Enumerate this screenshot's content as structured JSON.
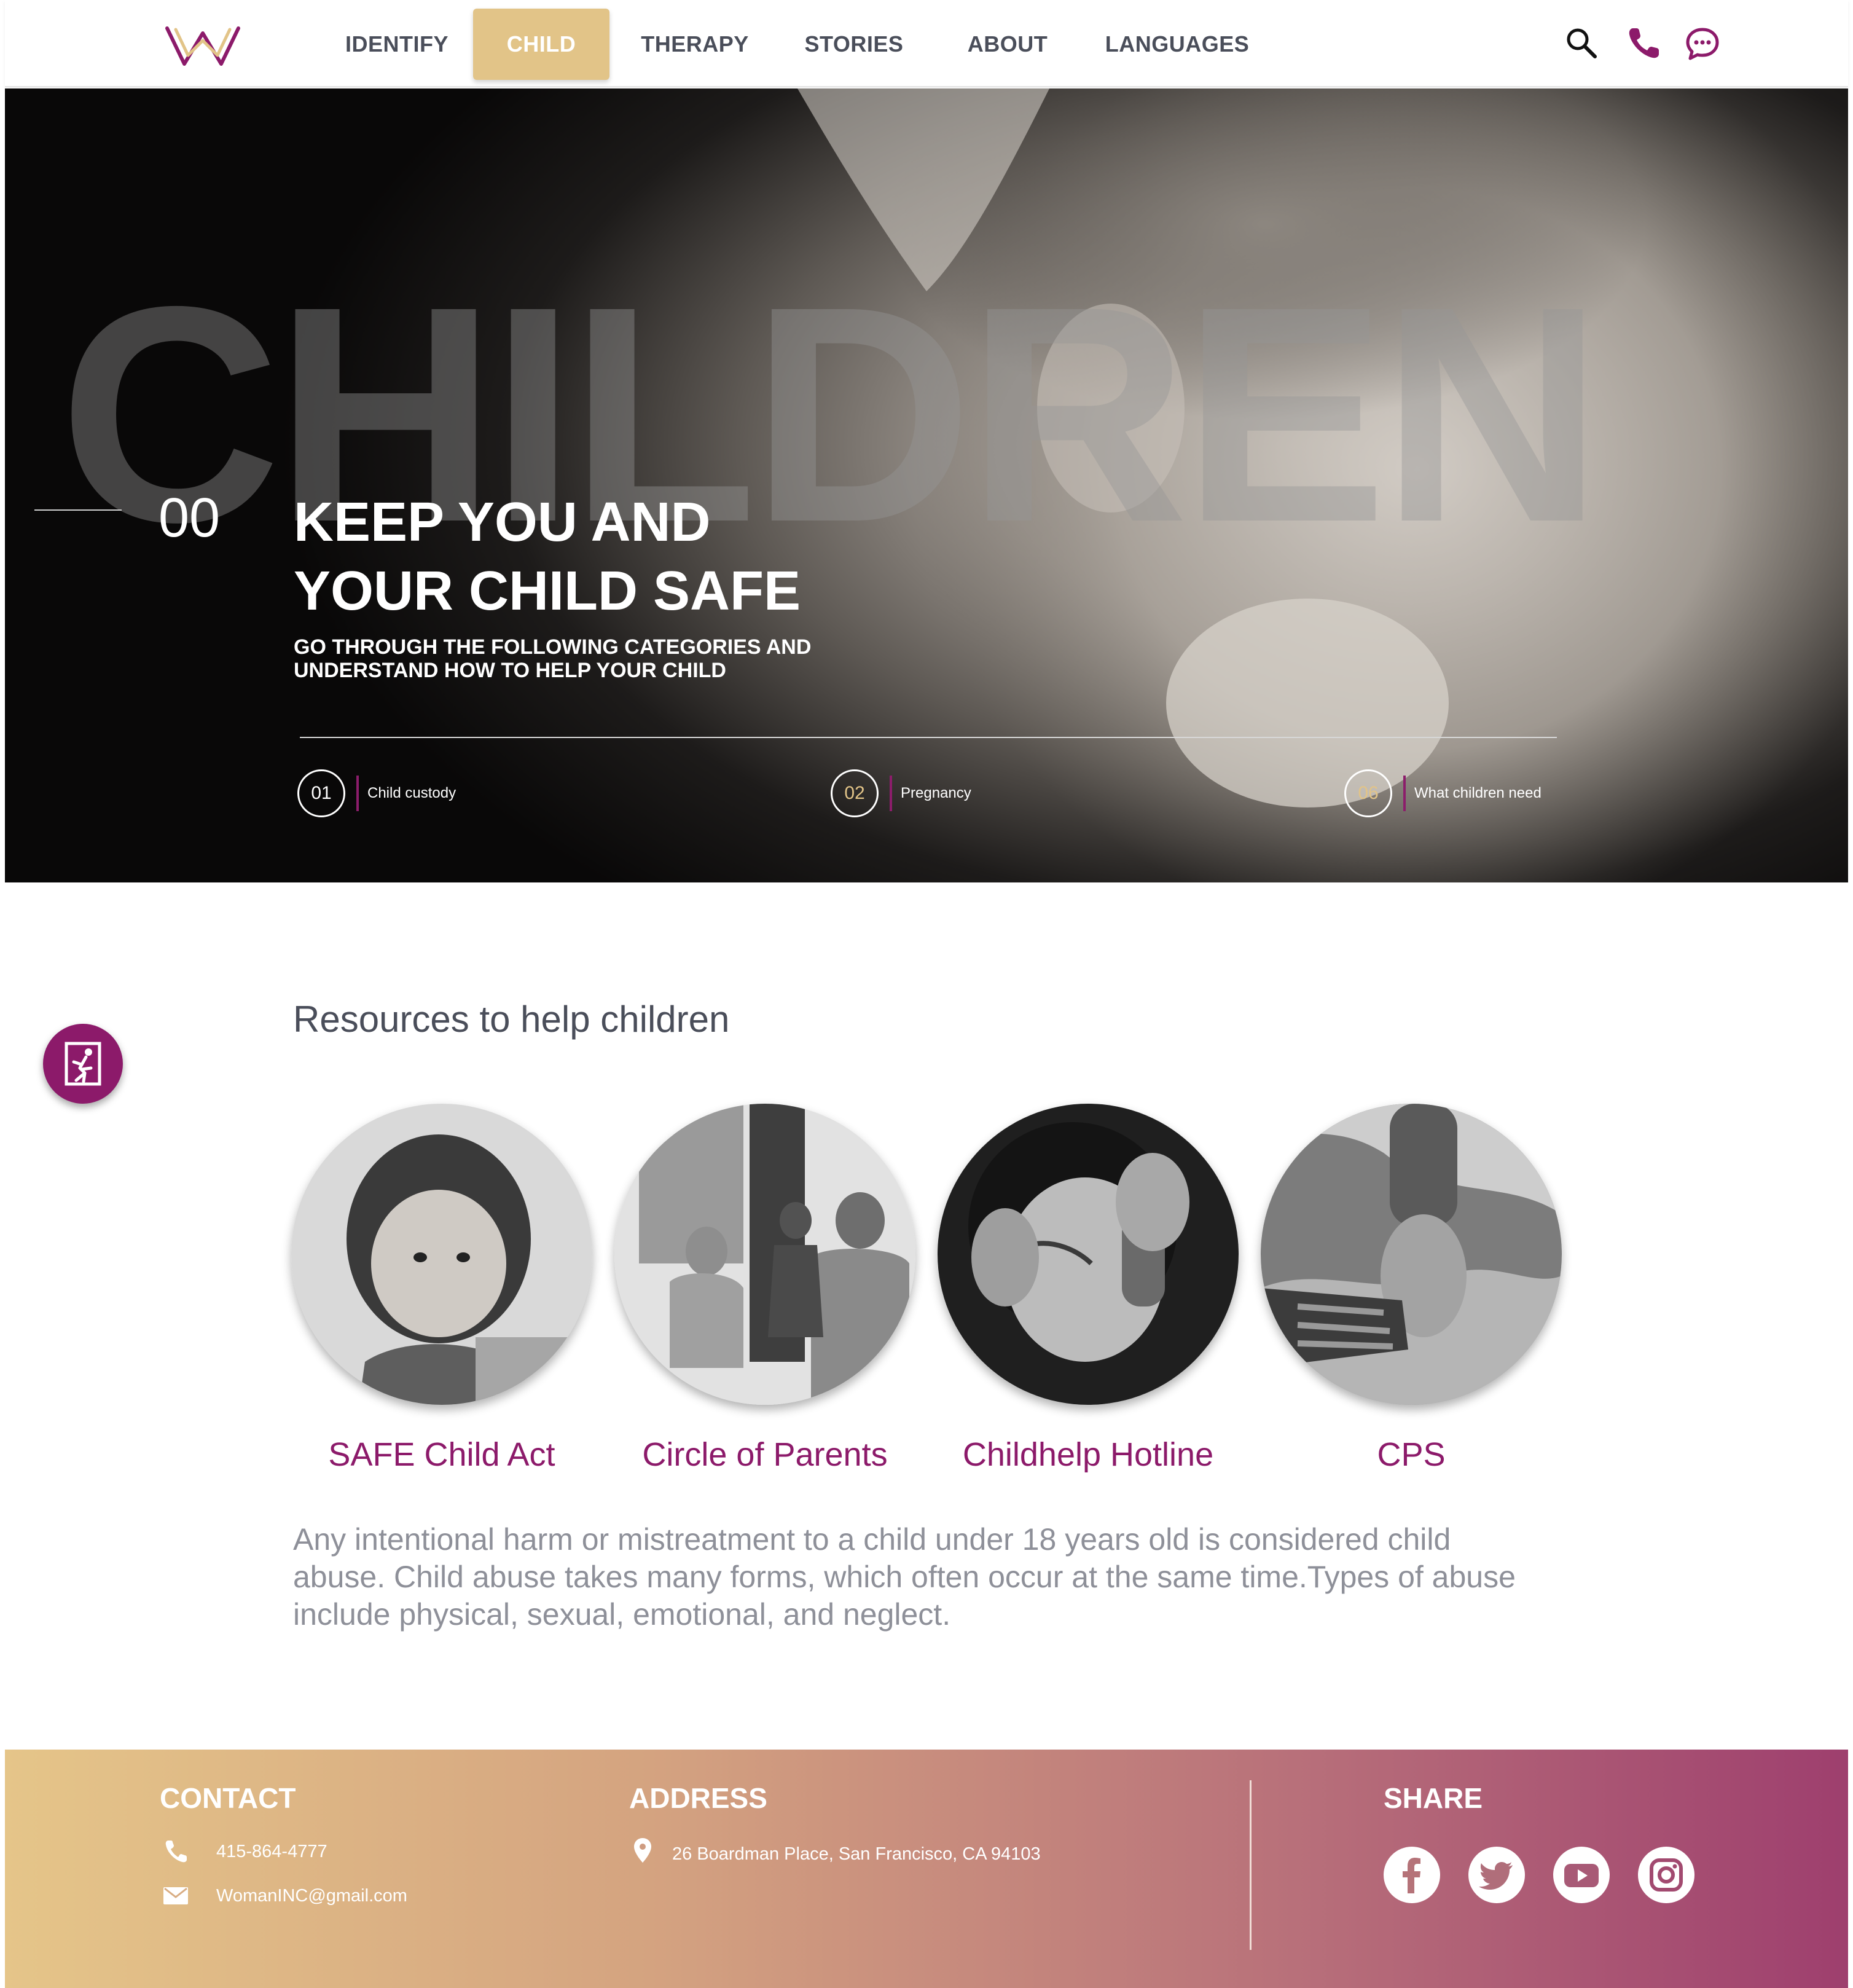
{
  "nav": {
    "logo_name": "WomanINC logo",
    "items": [
      {
        "label": "IDENTIFY",
        "active": false
      },
      {
        "label": "CHILD",
        "active": true
      },
      {
        "label": "THERAPY",
        "active": false
      },
      {
        "label": "STORIES",
        "active": false
      },
      {
        "label": "ABOUT",
        "active": false
      },
      {
        "label": "LANGUAGES",
        "active": false
      }
    ],
    "icons": [
      "search-icon",
      "phone-icon",
      "chat-icon"
    ]
  },
  "hero": {
    "background_word": "CHILDREN",
    "index": "00",
    "title_line1": "KEEP YOU AND",
    "title_line2": "YOUR CHILD SAFE",
    "subtitle_line1": "GO THROUGH THE FOLLOWING CATEGORIES AND",
    "subtitle_line2": "UNDERSTAND HOW TO HELP YOUR CHILD",
    "categories": [
      {
        "number": "01",
        "label": "Child custody"
      },
      {
        "number": "02",
        "label": "Pregnancy"
      },
      {
        "number": "06",
        "label": "What children need"
      }
    ]
  },
  "resources": {
    "title": "Resources to help children",
    "items": [
      {
        "label": "SAFE Child Act",
        "image": "toddler-photo"
      },
      {
        "label": "Circle of Parents",
        "image": "support-group-photo"
      },
      {
        "label": "Childhelp Hotline",
        "image": "woman-on-phone-photo"
      },
      {
        "label": "CPS",
        "image": "holding-hands-photo"
      }
    ],
    "description_line1": "Any intentional harm or mistreatment to a child under 18 years old is considered child",
    "description_line2": "abuse. Child abuse takes many forms, which often occur at the same time.Types of abuse",
    "description_line3": "include physical, sexual, emotional, and neglect."
  },
  "footer": {
    "contact": {
      "heading": "CONTACT",
      "phone": "415-864-4777",
      "email": "WomanINC@gmail.com"
    },
    "address": {
      "heading": "ADDRESS",
      "text": "26 Boardman Place, San Francisco, CA 94103"
    },
    "share": {
      "heading": "SHARE",
      "networks": [
        "facebook",
        "twitter",
        "youtube",
        "instagram"
      ]
    }
  },
  "colors": {
    "accent_gold": "#e2c488",
    "brand_purple": "#8c1a6a",
    "text_dark": "#4a4e5a",
    "text_muted": "#8e9099"
  }
}
